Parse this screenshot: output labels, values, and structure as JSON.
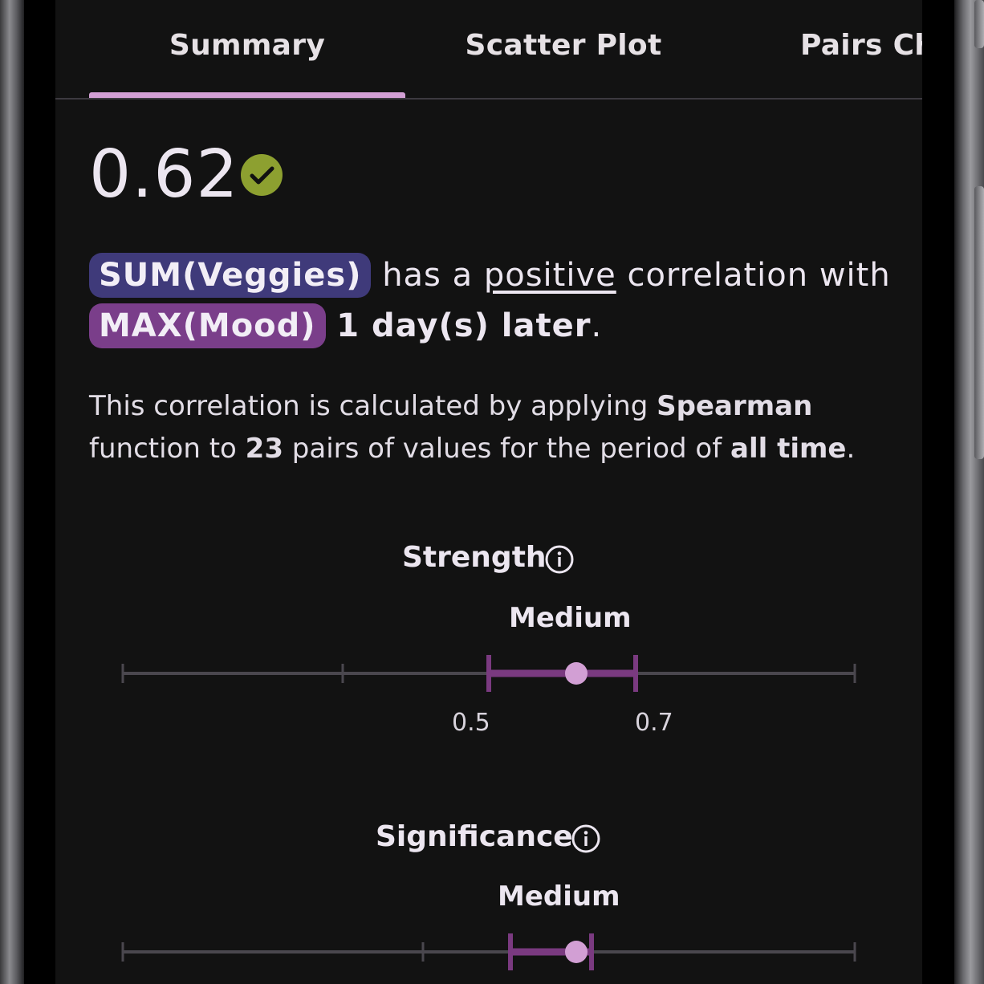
{
  "tabs": [
    {
      "label": "Summary",
      "active": true
    },
    {
      "label": "Scatter Plot",
      "active": false
    },
    {
      "label": "Pairs Ch",
      "active": false
    }
  ],
  "summary": {
    "value": "0.62",
    "status_icon": "check-circle-icon",
    "status_color": "#8da030"
  },
  "sentence": {
    "var1": "SUM(Veggies)",
    "mid1": "has a",
    "direction": "positive",
    "mid2": "correlation with",
    "var2": "MAX(Mood)",
    "lag": "1 day(s) later",
    "end": "."
  },
  "description": {
    "part1": "This correlation is calculated by applying",
    "method": "Spearman",
    "part2": "function to",
    "pairs": "23",
    "part3": "pairs of values for the period of",
    "period": "all time",
    "end": "."
  },
  "strength": {
    "title": "Strength",
    "level": "Medium",
    "value": 0.62,
    "range": [
      0.5,
      0.7
    ],
    "range_labels": [
      "0.5",
      "0.7"
    ]
  },
  "significance": {
    "title": "Significance",
    "level": "Medium"
  },
  "colors": {
    "accent": "#d29fd4",
    "range_bar": "#7a3a80",
    "chip_var1": "#3f3a7a",
    "chip_var2": "#7a3e8a"
  }
}
